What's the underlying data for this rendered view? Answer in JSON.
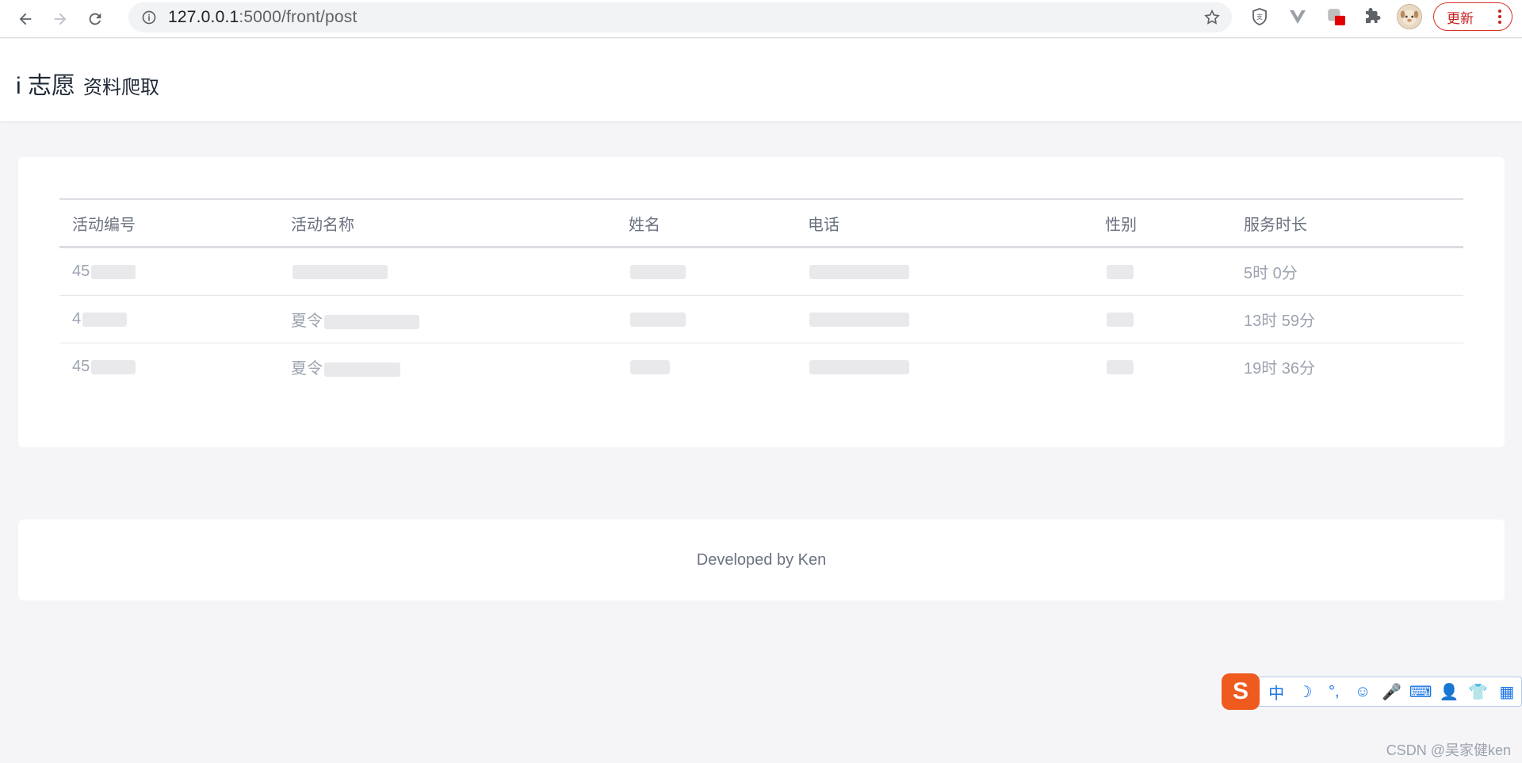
{
  "browser": {
    "url_host": "127.0.0.1",
    "url_rest": ":5000/front/post",
    "update_label": "更新",
    "icons": [
      "back-arrow-icon",
      "forward-arrow-icon",
      "reload-icon",
      "info-icon",
      "star-icon",
      "shield-extension-icon",
      "vue-devtools-icon",
      "extension-badge-icon",
      "puzzle-icon",
      "profile-avatar-icon",
      "more-vert-icon"
    ]
  },
  "header": {
    "brand_name": "i 志愿",
    "brand_sub": "资料爬取"
  },
  "table": {
    "columns": [
      "活动编号",
      "活动名称",
      "姓名",
      "电话",
      "性别",
      "服务时长"
    ],
    "rows": [
      {
        "id_prefix": "45",
        "activity_prefix": "",
        "duration": "5时 0分"
      },
      {
        "id_prefix": "4",
        "activity_prefix": "夏令",
        "duration": "13时 59分"
      },
      {
        "id_prefix": "45",
        "activity_prefix": "夏令",
        "duration": "19时 36分"
      }
    ]
  },
  "footer": {
    "text": "Developed by Ken"
  },
  "ime": {
    "logo": "S",
    "items": [
      "中",
      "☽",
      "°,",
      "☺",
      "🎤",
      "⌨",
      "👤",
      "👕",
      "▦"
    ]
  },
  "watermark": "CSDN @吴家健ken",
  "colors": {
    "update_red": "#d93025",
    "ime_orange": "#ef5a1f",
    "ime_blue": "#1a73e8"
  }
}
